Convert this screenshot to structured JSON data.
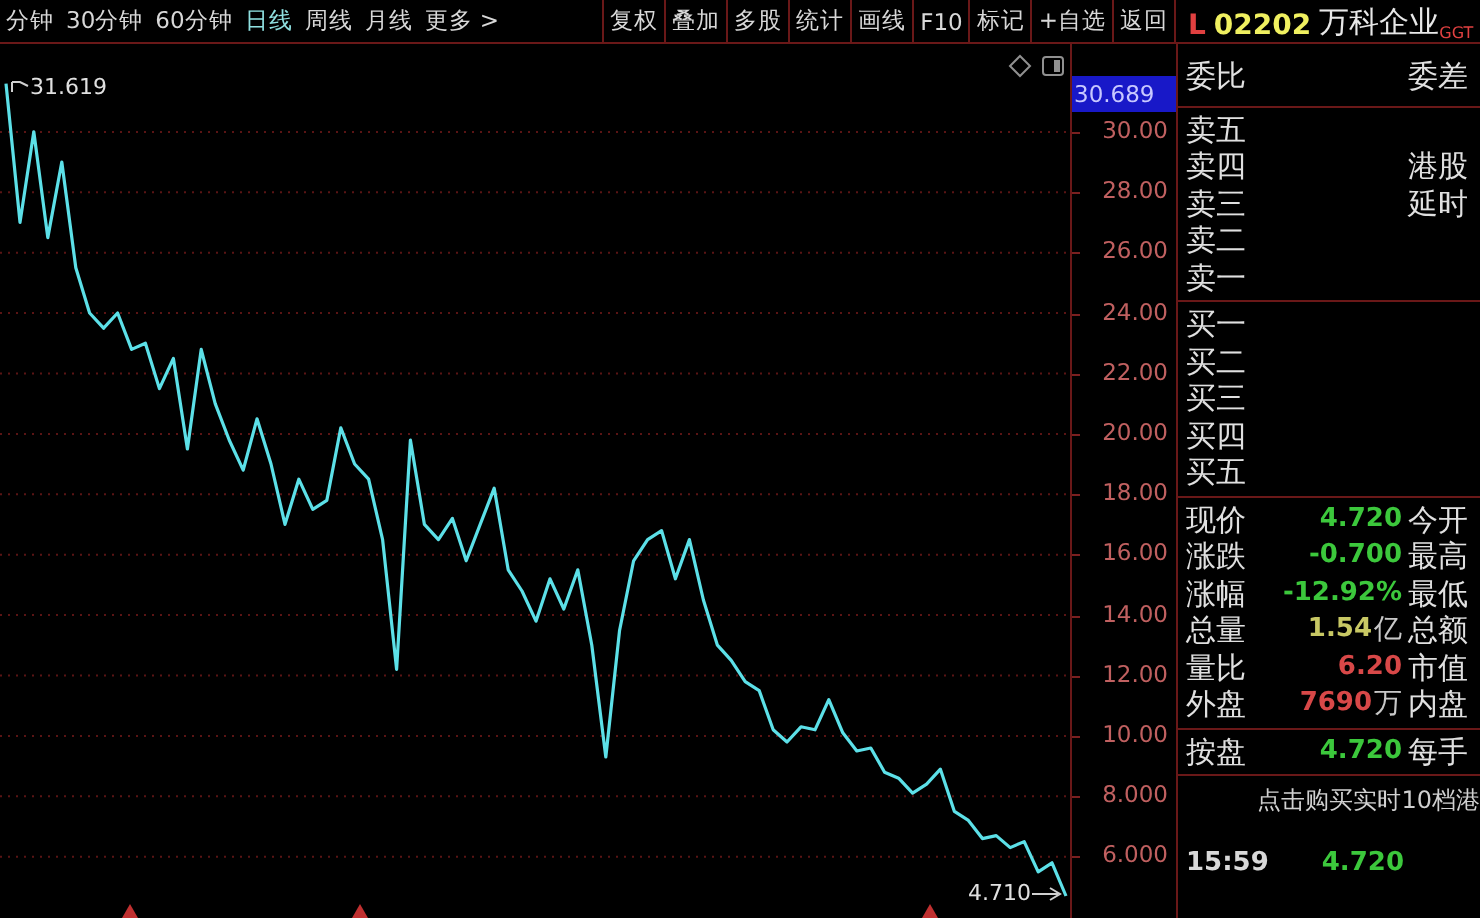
{
  "toolbar": {
    "periods": [
      {
        "label": "分钟",
        "selected": false
      },
      {
        "label": "30分钟",
        "selected": false
      },
      {
        "label": "60分钟",
        "selected": false
      },
      {
        "label": "日线",
        "selected": true
      },
      {
        "label": "周线",
        "selected": false
      },
      {
        "label": "月线",
        "selected": false
      },
      {
        "label": "更多 >",
        "selected": false
      }
    ],
    "buttons": [
      "复权",
      "叠加",
      "多股",
      "统计",
      "画线",
      "F10",
      "标记",
      "+自选",
      "返回"
    ]
  },
  "chart": {
    "high_label": "31.619",
    "low_label": "4.710",
    "current_price": "30.689",
    "chart_data": {
      "type": "line",
      "grid": true,
      "ylim": [
        3.97,
        32.91
      ],
      "yticks": [
        {
          "value": 30,
          "label": "30.00"
        },
        {
          "value": 28,
          "label": "28.00"
        },
        {
          "value": 26,
          "label": "26.00"
        },
        {
          "value": 24,
          "label": "24.00"
        },
        {
          "value": 22,
          "label": "22.00"
        },
        {
          "value": 20,
          "label": "20.00"
        },
        {
          "value": 18,
          "label": "18.00"
        },
        {
          "value": 16,
          "label": "16.00"
        },
        {
          "value": 14,
          "label": "14.00"
        },
        {
          "value": 12,
          "label": "12.00"
        },
        {
          "value": 10,
          "label": "10.00"
        },
        {
          "value": 8,
          "label": "8.000"
        },
        {
          "value": 6,
          "label": "6.000"
        }
      ],
      "series": [
        {
          "color": "#5ce0e8",
          "values": [
            31.6,
            27,
            30,
            26.5,
            29,
            25.5,
            24,
            23.5,
            24,
            22.8,
            23,
            21.5,
            22.5,
            19.5,
            22.8,
            21,
            19.8,
            18.8,
            20.5,
            19,
            17,
            18.5,
            17.5,
            17.8,
            20.2,
            19,
            18.5,
            16.5,
            12.2,
            19.8,
            17,
            16.5,
            17.2,
            15.8,
            17,
            18.2,
            15.5,
            14.8,
            13.8,
            15.2,
            14.2,
            15.5,
            13,
            9.3,
            13.5,
            15.8,
            16.5,
            16.8,
            15.2,
            16.5,
            14.5,
            13,
            12.5,
            11.8,
            11.5,
            10.2,
            9.8,
            10.3,
            10.2,
            11.2,
            10.1,
            9.5,
            9.6,
            8.8,
            8.6,
            8.1,
            8.4,
            8.9,
            7.5,
            7.2,
            6.6,
            6.7,
            6.3,
            6.5,
            5.5,
            5.8,
            4.7
          ]
        }
      ]
    }
  },
  "quote": {
    "market_flag": "L",
    "code": "02202",
    "name": "万科企业",
    "badge": "GGT",
    "ratio_label": "委比",
    "diff_label": "委差",
    "sell_levels": [
      {
        "label": "卖五"
      },
      {
        "label": "卖四",
        "note": "港股"
      },
      {
        "label": "卖三",
        "note": "延时"
      },
      {
        "label": "卖二"
      },
      {
        "label": "卖一"
      }
    ],
    "buy_levels": [
      {
        "label": "买一"
      },
      {
        "label": "买二"
      },
      {
        "label": "买三"
      },
      {
        "label": "买四"
      },
      {
        "label": "买五"
      }
    ],
    "stats": [
      {
        "label": "现价",
        "value": "4.720",
        "color": "#3cc83c",
        "label2": "今开"
      },
      {
        "label": "涨跌",
        "value": "-0.700",
        "color": "#3cc83c",
        "label2": "最高"
      },
      {
        "label": "涨幅",
        "value": "-12.92%",
        "color": "#3cc83c",
        "label2": "最低"
      },
      {
        "label": "总量",
        "value": "1.54",
        "unit": "亿",
        "color": "#c8c864",
        "label2": "总额"
      },
      {
        "label": "量比",
        "value": "6.20",
        "color": "#d84848",
        "label2": "市值"
      },
      {
        "label": "外盘",
        "value": "7690",
        "unit": "万",
        "color": "#d84848",
        "label2": "内盘"
      }
    ],
    "after_hours": {
      "label": "按盘",
      "value": "4.720",
      "color": "#3cc83c",
      "label2": "每手"
    },
    "promo": "点击购买实时10档港",
    "ticks": [
      {
        "time": "15:59",
        "price": "4.720",
        "color": "#3cc83c"
      }
    ]
  }
}
